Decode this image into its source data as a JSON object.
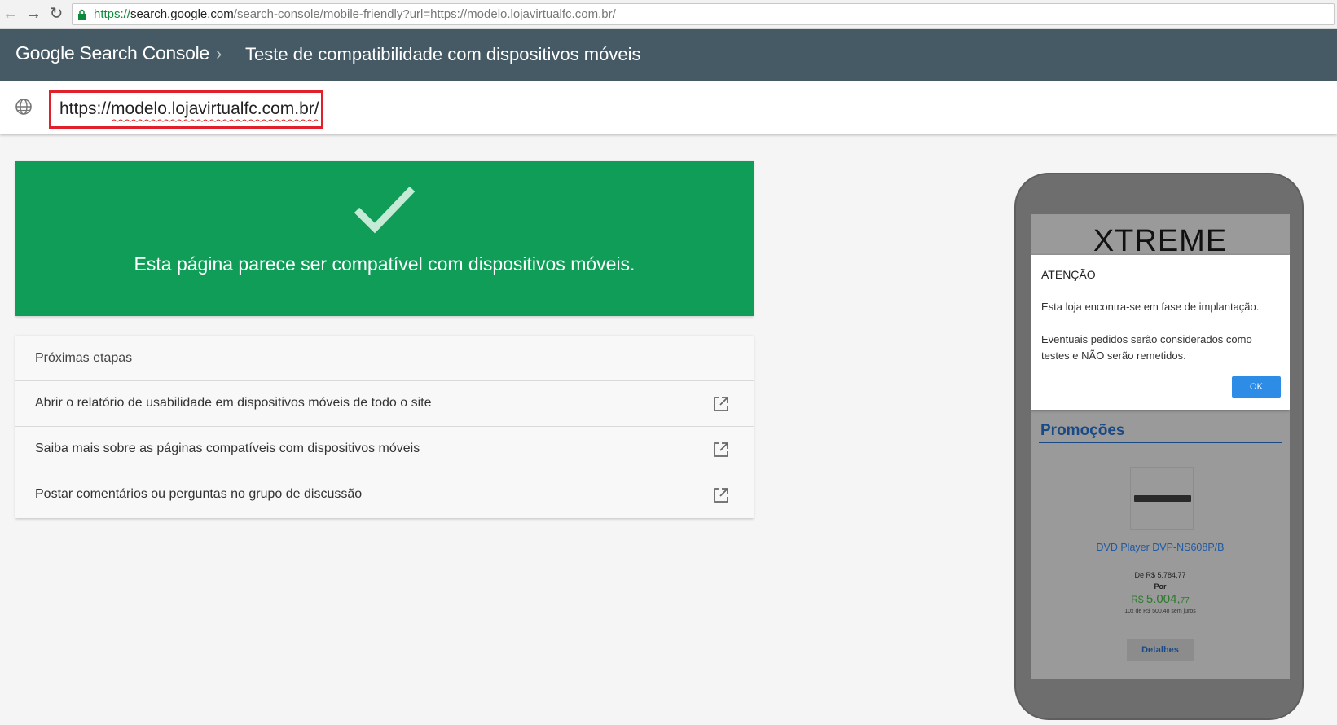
{
  "browser": {
    "url_scheme": "https://",
    "url_host": "search.google.com",
    "url_rest": "/search-console/mobile-friendly?url=https://modelo.lojavirtualfc.com.br/",
    "back_icon": "arrow-left-icon",
    "forward_icon": "arrow-right-icon",
    "reload_icon": "reload-icon",
    "lock_icon": "lock-icon"
  },
  "header": {
    "brand_google": "Google",
    "brand_product": " Search Console",
    "separator": "›",
    "title": "Teste de compatibilidade com dispositivos móveis",
    "background": "#455a64"
  },
  "url_input": {
    "value": "https://modelo.lojavirtualfc.com.br/",
    "icon": "globe-icon",
    "highlight_color": "#e0202a"
  },
  "result": {
    "message": "Esta página parece ser compatível com dispositivos móveis.",
    "icon": "checkmark-icon",
    "color": "#0f9d58"
  },
  "next_steps": {
    "title": "Próximas etapas",
    "items": [
      {
        "label": "Abrir o relatório de usabilidade em dispositivos móveis de todo o site",
        "icon": "open-in-new-icon"
      },
      {
        "label": "Saiba mais sobre as páginas compatíveis com dispositivos móveis",
        "icon": "open-in-new-icon"
      },
      {
        "label": "Postar comentários ou perguntas no grupo de discussão",
        "icon": "open-in-new-icon"
      }
    ]
  },
  "preview": {
    "site_logo": "XTREME",
    "modal": {
      "title": "ATENÇÃO",
      "line1": "Esta loja encontra-se em fase de implantação.",
      "line2": "Eventuais pedidos serão considerados como",
      "line3": "testes e NÃO serão remetidos.",
      "ok_label": "OK"
    },
    "section_title": "Promoções",
    "product": {
      "name": "DVD Player DVP-NS608P/B",
      "price_from": "De  R$ 5.784,77",
      "price_por": "Por",
      "price_currency": "R$ ",
      "price_main": "5.004,",
      "price_cents": "77",
      "installments": "10x de R$ 500,48 sem juros",
      "details_label": "Detalhes"
    }
  }
}
